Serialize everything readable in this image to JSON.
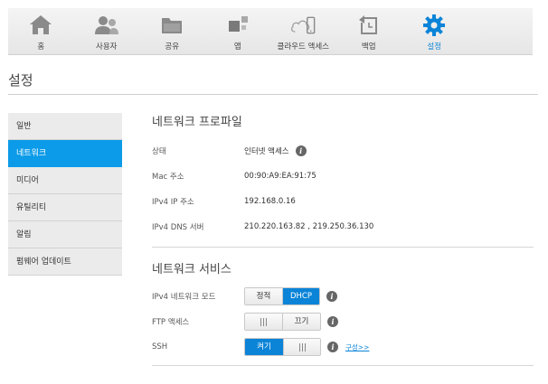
{
  "nav": [
    {
      "label": "홈",
      "icon": "home-icon"
    },
    {
      "label": "사용자",
      "icon": "users-icon"
    },
    {
      "label": "공유",
      "icon": "folder-icon"
    },
    {
      "label": "앱",
      "icon": "apps-icon"
    },
    {
      "label": "클라우드 액세스",
      "icon": "cloud-access-icon"
    },
    {
      "label": "백업",
      "icon": "backup-icon"
    },
    {
      "label": "설정",
      "icon": "gear-icon",
      "active": true
    }
  ],
  "page_title": "설정",
  "sidebar": [
    {
      "label": "일반"
    },
    {
      "label": "네트워크",
      "active": true
    },
    {
      "label": "미디어"
    },
    {
      "label": "유틸리티"
    },
    {
      "label": "알림"
    },
    {
      "label": "펌웨어 업데이트"
    }
  ],
  "profile": {
    "title": "네트워크 프로파일",
    "rows": [
      {
        "label": "상태",
        "value": "인터넷 액세스"
      },
      {
        "label": "Mac 주소",
        "value": "00:90:A9:EA:91:75"
      },
      {
        "label": "IPv4 IP 주소",
        "value": "192.168.0.16"
      },
      {
        "label": "IPv4 DNS 서버",
        "value": "210.220.163.82 , 219.250.36.130"
      }
    ]
  },
  "services": {
    "title": "네트워크 서비스",
    "ipv4_mode": {
      "label": "IPv4 네트워크 모드",
      "option_static": "정적",
      "option_dhcp": "DHCP",
      "selected": "DHCP"
    },
    "ftp": {
      "label": "FTP 액세스",
      "state_label": "끄기",
      "on": false
    },
    "ssh": {
      "label": "SSH",
      "state_label": "켜기",
      "on": true,
      "config_link": "구성>>"
    }
  },
  "colors": {
    "accent": "#0b84d8",
    "sidebar_active": "#0b9be8"
  }
}
